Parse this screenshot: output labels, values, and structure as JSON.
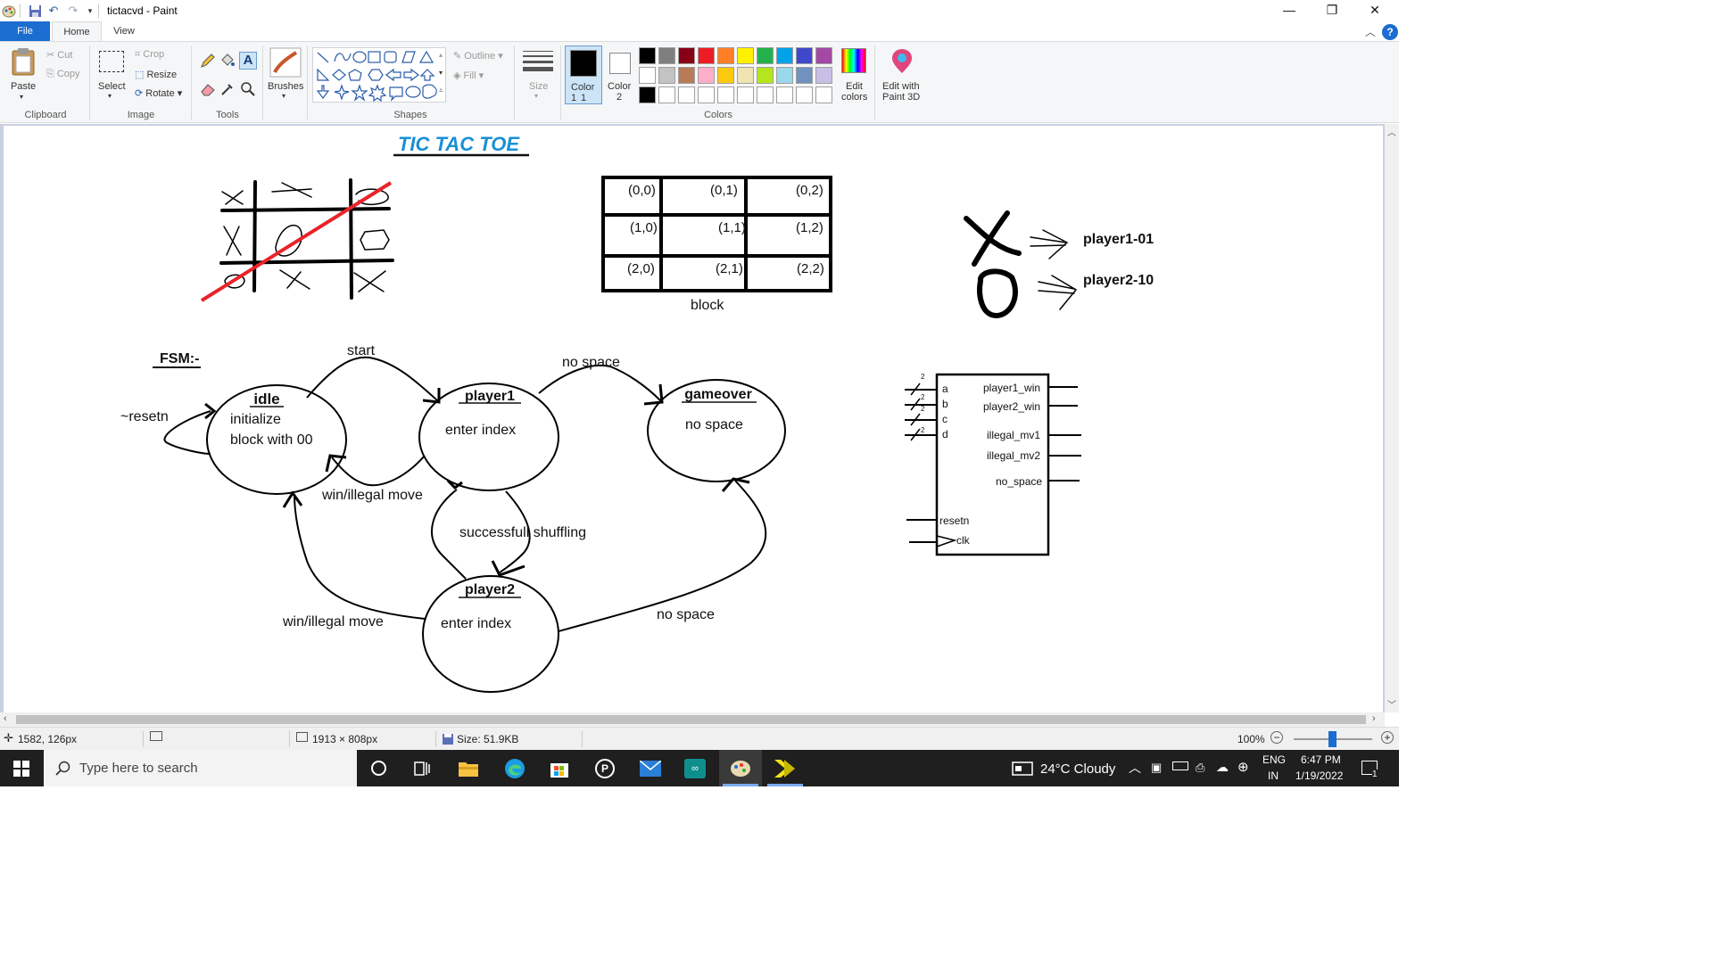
{
  "window": {
    "title": "tictacvd - Paint",
    "controls": {
      "minimize": "—",
      "restore": "❐",
      "close": "✕"
    }
  },
  "tabs": {
    "file": "File",
    "home": "Home",
    "view": "View"
  },
  "ribbon": {
    "clipboard": {
      "paste": "Paste",
      "cut": "Cut",
      "copy": "Copy",
      "group": "Clipboard"
    },
    "image": {
      "select": "Select",
      "crop": "Crop",
      "resize": "Resize",
      "rotate": "Rotate",
      "group": "Image"
    },
    "tools": {
      "group": "Tools"
    },
    "brushes": {
      "label": "Brushes"
    },
    "shapes": {
      "outline": "Outline",
      "fill": "Fill",
      "group": "Shapes"
    },
    "size": {
      "label": "Size"
    },
    "colors": {
      "color1": "Color 1",
      "color1_num": "1",
      "color2": "Color",
      "color2_num": "2",
      "edit_colors": "Edit",
      "edit_colors_2": "colors",
      "paint3d": "Edit with",
      "paint3d_2": "Paint 3D",
      "group": "Colors",
      "palette_row1": [
        "#000000",
        "#7f7f7f",
        "#880015",
        "#ed1c24",
        "#ff7f27",
        "#fff200",
        "#22b14c",
        "#00a2e8",
        "#3f48cc",
        "#a349a4"
      ],
      "palette_row2": [
        "#ffffff",
        "#c3c3c3",
        "#b97a57",
        "#ffaec9",
        "#ffc90e",
        "#efe4b0",
        "#b5e61d",
        "#99d9ea",
        "#7092be",
        "#c8bfe7"
      ],
      "palette_row3": [
        "#000000",
        "#ffffff",
        "#ffffff",
        "#ffffff",
        "#ffffff",
        "#ffffff",
        "#ffffff",
        "#ffffff",
        "#ffffff",
        "#ffffff"
      ]
    }
  },
  "canvas": {
    "title": "TIC TAC TOE",
    "grid_coords": [
      "(0,0)",
      "(0,1)",
      "(0,2)",
      "(1,0)",
      "(1,1)",
      "(1,2)",
      "(2,0)",
      "(2,1)",
      "(2,2)"
    ],
    "grid_caption": "block",
    "legend": {
      "p1": "player1-01",
      "p2": "player2-10"
    },
    "fsm_label": "FSM:-",
    "states": {
      "idle": {
        "name": "idle",
        "line1": "initialize",
        "line2": "block with 00"
      },
      "player1": {
        "name": "player1",
        "text": "enter index"
      },
      "gameover": {
        "name": "gameover",
        "text": "no space"
      },
      "player2": {
        "name": "player2",
        "text": "enter index"
      }
    },
    "transitions": {
      "reset": "~resetn",
      "start": "start",
      "p1_nospace": "no space",
      "p1_win": "win/illegal move",
      "shuffle": "successfull shuffling",
      "p2_win": "win/illegal move",
      "p2_nospace": "no space"
    },
    "block": {
      "inputs": [
        "a",
        "b",
        "c",
        "d"
      ],
      "input_width": "2",
      "outputs": [
        "player1_win",
        "player2_win",
        "illegal_mv1",
        "illegal_mv2",
        "no_space"
      ],
      "resetn": "resetn",
      "clk": "clk"
    }
  },
  "status": {
    "cursor": "1582, 126px",
    "canvas_size": "1913 × 808px",
    "file_size": "Size: 51.9KB",
    "zoom": "100%"
  },
  "taskbar": {
    "search_placeholder": "Type here to search",
    "weather": "24°C  Cloudy",
    "lang1": "ENG",
    "lang2": "IN",
    "time": "6:47 PM",
    "date": "1/19/2022",
    "notifications": "1"
  }
}
